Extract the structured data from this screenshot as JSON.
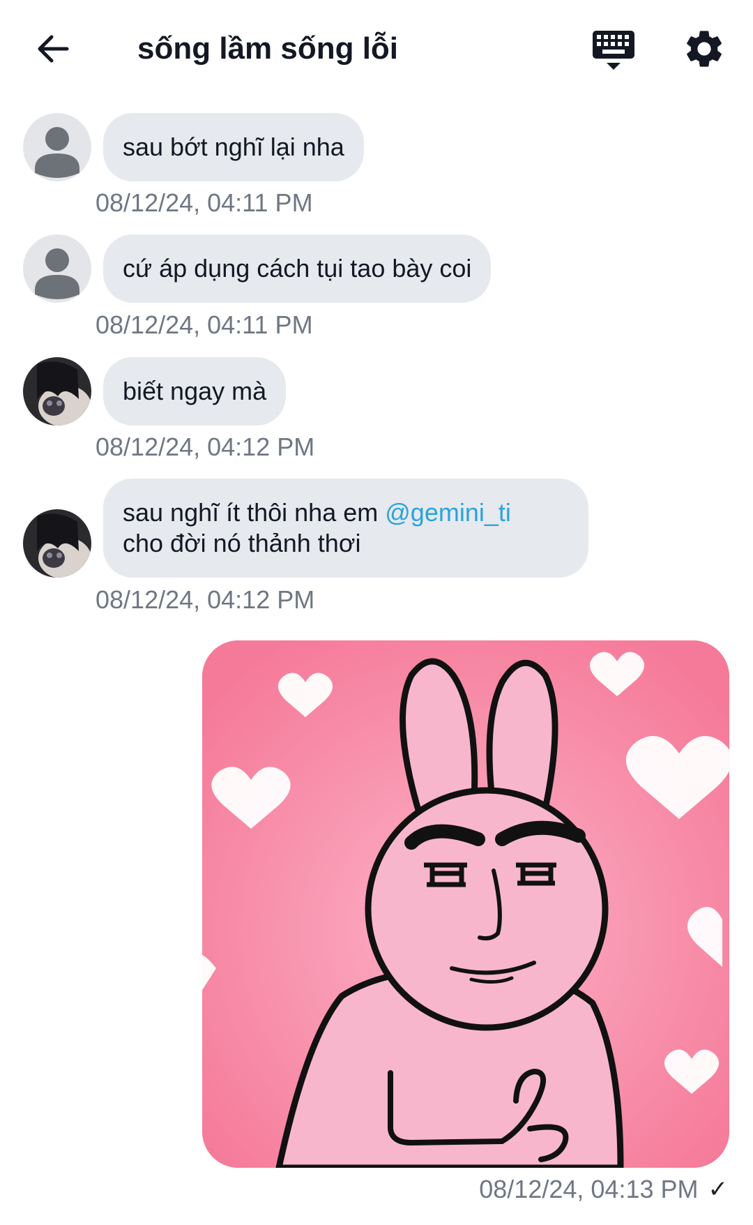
{
  "header": {
    "title": "sống lầm sống lỗi"
  },
  "messages": [
    {
      "text": "sau bớt nghĩ lại nha",
      "timestamp": "08/12/24, 04:11 PM",
      "avatar": "default-avatar"
    },
    {
      "text": "cứ áp dụng cách tụi tao bày coi",
      "timestamp": "08/12/24, 04:11 PM",
      "avatar": "default-avatar"
    },
    {
      "text": "biết ngay mà",
      "timestamp": "08/12/24, 04:12 PM",
      "avatar": "profile-photo"
    },
    {
      "text_before": "sau nghĩ ít thôi nha em ",
      "mention": "@gemini_ti",
      "text_after": "cho đời nó thảnh thơi",
      "timestamp": "08/12/24, 04:12 PM",
      "avatar": "profile-photo"
    }
  ],
  "sent": {
    "sticker": "pink-bunny-thumbs-up-sticker",
    "timestamp": "08/12/24, 04:13 PM",
    "status": "✓"
  },
  "colors": {
    "bubble": "#e6e9ee",
    "timestamp": "#6f7684",
    "mention": "#2aa3dd",
    "sticker_bg": "#f7839f",
    "bunny": "#f8b6cc"
  },
  "icons": {
    "back": "arrow-left-icon",
    "keyboard": "keyboard-icon",
    "settings": "gear-icon"
  }
}
